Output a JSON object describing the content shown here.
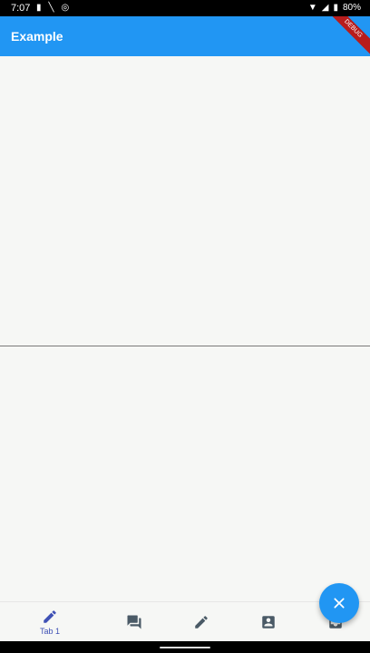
{
  "status_bar": {
    "time": "7:07",
    "battery": "80%"
  },
  "app_bar": {
    "title": "Example",
    "debug_banner": "DEBUG"
  },
  "bottom_nav": {
    "items": [
      {
        "label": "Tab 1",
        "icon": "pencil-icon",
        "selected": true
      },
      {
        "label": "",
        "icon": "chat-icon",
        "selected": false
      },
      {
        "label": "",
        "icon": "pencil-icon",
        "selected": false
      },
      {
        "label": "",
        "icon": "contact-icon",
        "selected": false
      },
      {
        "label": "",
        "icon": "inbox-icon",
        "selected": false
      }
    ]
  },
  "fab": {
    "icon": "close-icon"
  },
  "colors": {
    "primary": "#2196f3",
    "selected_nav": "#3f51b5",
    "unselected_nav": "#4a5a66",
    "background": "#f6f7f5"
  }
}
